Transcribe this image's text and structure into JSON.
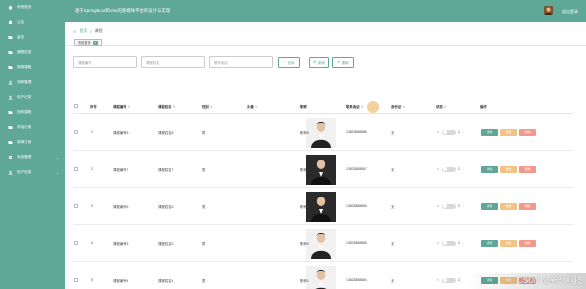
{
  "app": {
    "title": "基于SpringBoot和Vue的新媒体平台的设计与实现",
    "logout_label": "退出登录"
  },
  "sidebar": {
    "items": [
      {
        "label": "系统首页",
        "icon": "home-icon",
        "has_arrow": false
      },
      {
        "label": "公告",
        "icon": "bell-icon",
        "has_arrow": false
      },
      {
        "label": "留言",
        "icon": "folder-icon",
        "has_arrow": false
      },
      {
        "label": "课程信息",
        "icon": "folder-icon",
        "has_arrow": false
      },
      {
        "label": "视频课程",
        "icon": "folder-icon",
        "has_arrow": false
      },
      {
        "label": "领养管理",
        "icon": "user-icon",
        "has_arrow": false
      },
      {
        "label": "用户记录",
        "icon": "user-icon",
        "has_arrow": false
      },
      {
        "label": "回收课程",
        "icon": "folder-icon",
        "has_arrow": false
      },
      {
        "label": "学者记录",
        "icon": "folder-icon",
        "has_arrow": false
      },
      {
        "label": "新闻订阅",
        "icon": "folder-icon",
        "has_arrow": false
      },
      {
        "label": "系统管理",
        "icon": "gear-icon",
        "has_arrow": true
      },
      {
        "label": "用户信息",
        "icon": "user-icon",
        "has_arrow": true
      }
    ]
  },
  "breadcrumb": {
    "home": "首页",
    "current": "课程"
  },
  "tags": {
    "active": "系统首页"
  },
  "filters": {
    "inputs": [
      {
        "placeholder": "课程编号"
      },
      {
        "placeholder": "课程姓名"
      },
      {
        "placeholder": "联系电话"
      }
    ],
    "search_label": "查询",
    "add_label": "新增",
    "delete_label": "删除"
  },
  "table": {
    "columns": [
      "序号",
      "课程编号",
      "课程姓名",
      "性别",
      "头像",
      "职称",
      "联系电话",
      "身份证",
      "状态",
      "操作"
    ],
    "rows": [
      {
        "index": "1",
        "code": "课程编号8",
        "name": "课程姓名8",
        "gender": "男",
        "title": "职称8",
        "phone": "13823888888",
        "id_card": "无",
        "photo_variant": "light"
      },
      {
        "index": "2",
        "code": "课程编号7",
        "name": "课程姓名7",
        "gender": "男",
        "title": "职称7",
        "phone": "13823888887",
        "id_card": "无",
        "photo_variant": "dark"
      },
      {
        "index": "3",
        "code": "课程编号6",
        "name": "课程姓名6",
        "gender": "男",
        "title": "职称6",
        "phone": "13823888886",
        "id_card": "无",
        "photo_variant": "dark"
      },
      {
        "index": "4",
        "code": "课程编号5",
        "name": "课程姓名5",
        "gender": "男",
        "title": "职称5",
        "phone": "13823888885",
        "id_card": "无",
        "photo_variant": "light"
      },
      {
        "index": "5",
        "code": "课程编号4",
        "name": "课程姓名4",
        "gender": "男",
        "title": "职称4",
        "phone": "13823888884",
        "id_card": "无",
        "photo_variant": "light"
      }
    ],
    "switch_off_label": "<",
    "switch_on_label": "Z",
    "actions": {
      "view": "详情",
      "edit": "修改",
      "delete": "删除"
    }
  },
  "watermark": "CSDN @新时科技",
  "colors": {
    "primary": "#5fa797",
    "edit": "#f3c385",
    "delete": "#f19a8c"
  }
}
